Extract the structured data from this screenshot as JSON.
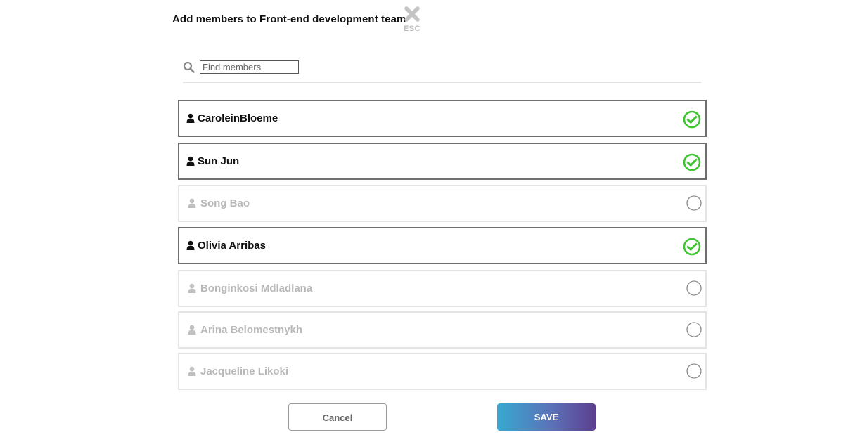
{
  "dialog": {
    "title": "Add members to Front-end development team",
    "close_label": "ESC"
  },
  "search": {
    "placeholder": "Find members",
    "value": ""
  },
  "members": [
    {
      "name": "CaroleinBloeme",
      "selected": true
    },
    {
      "name": "Sun Jun",
      "selected": true
    },
    {
      "name": "Song Bao",
      "selected": false
    },
    {
      "name": "Olivia Arribas",
      "selected": true
    },
    {
      "name": "Bonginkosi Mdladlana",
      "selected": false
    },
    {
      "name": "Arina Belomestnykh",
      "selected": false
    },
    {
      "name": "Jacqueline Likoki",
      "selected": false
    }
  ],
  "buttons": {
    "cancel_label": "Cancel",
    "save_label": "SAVE"
  },
  "colors": {
    "check_green": "#3fc531",
    "selected_border": "#707070",
    "unselected_border": "#e4e4e4",
    "unselected_text": "#b8b8b8",
    "save_gradient_start": "#37a9d1",
    "save_gradient_end": "#5d3f8f"
  },
  "icons": {
    "close": "close-icon",
    "search": "search-icon",
    "person": "person-icon",
    "checked": "check-circle-icon",
    "unchecked": "empty-circle-icon"
  }
}
